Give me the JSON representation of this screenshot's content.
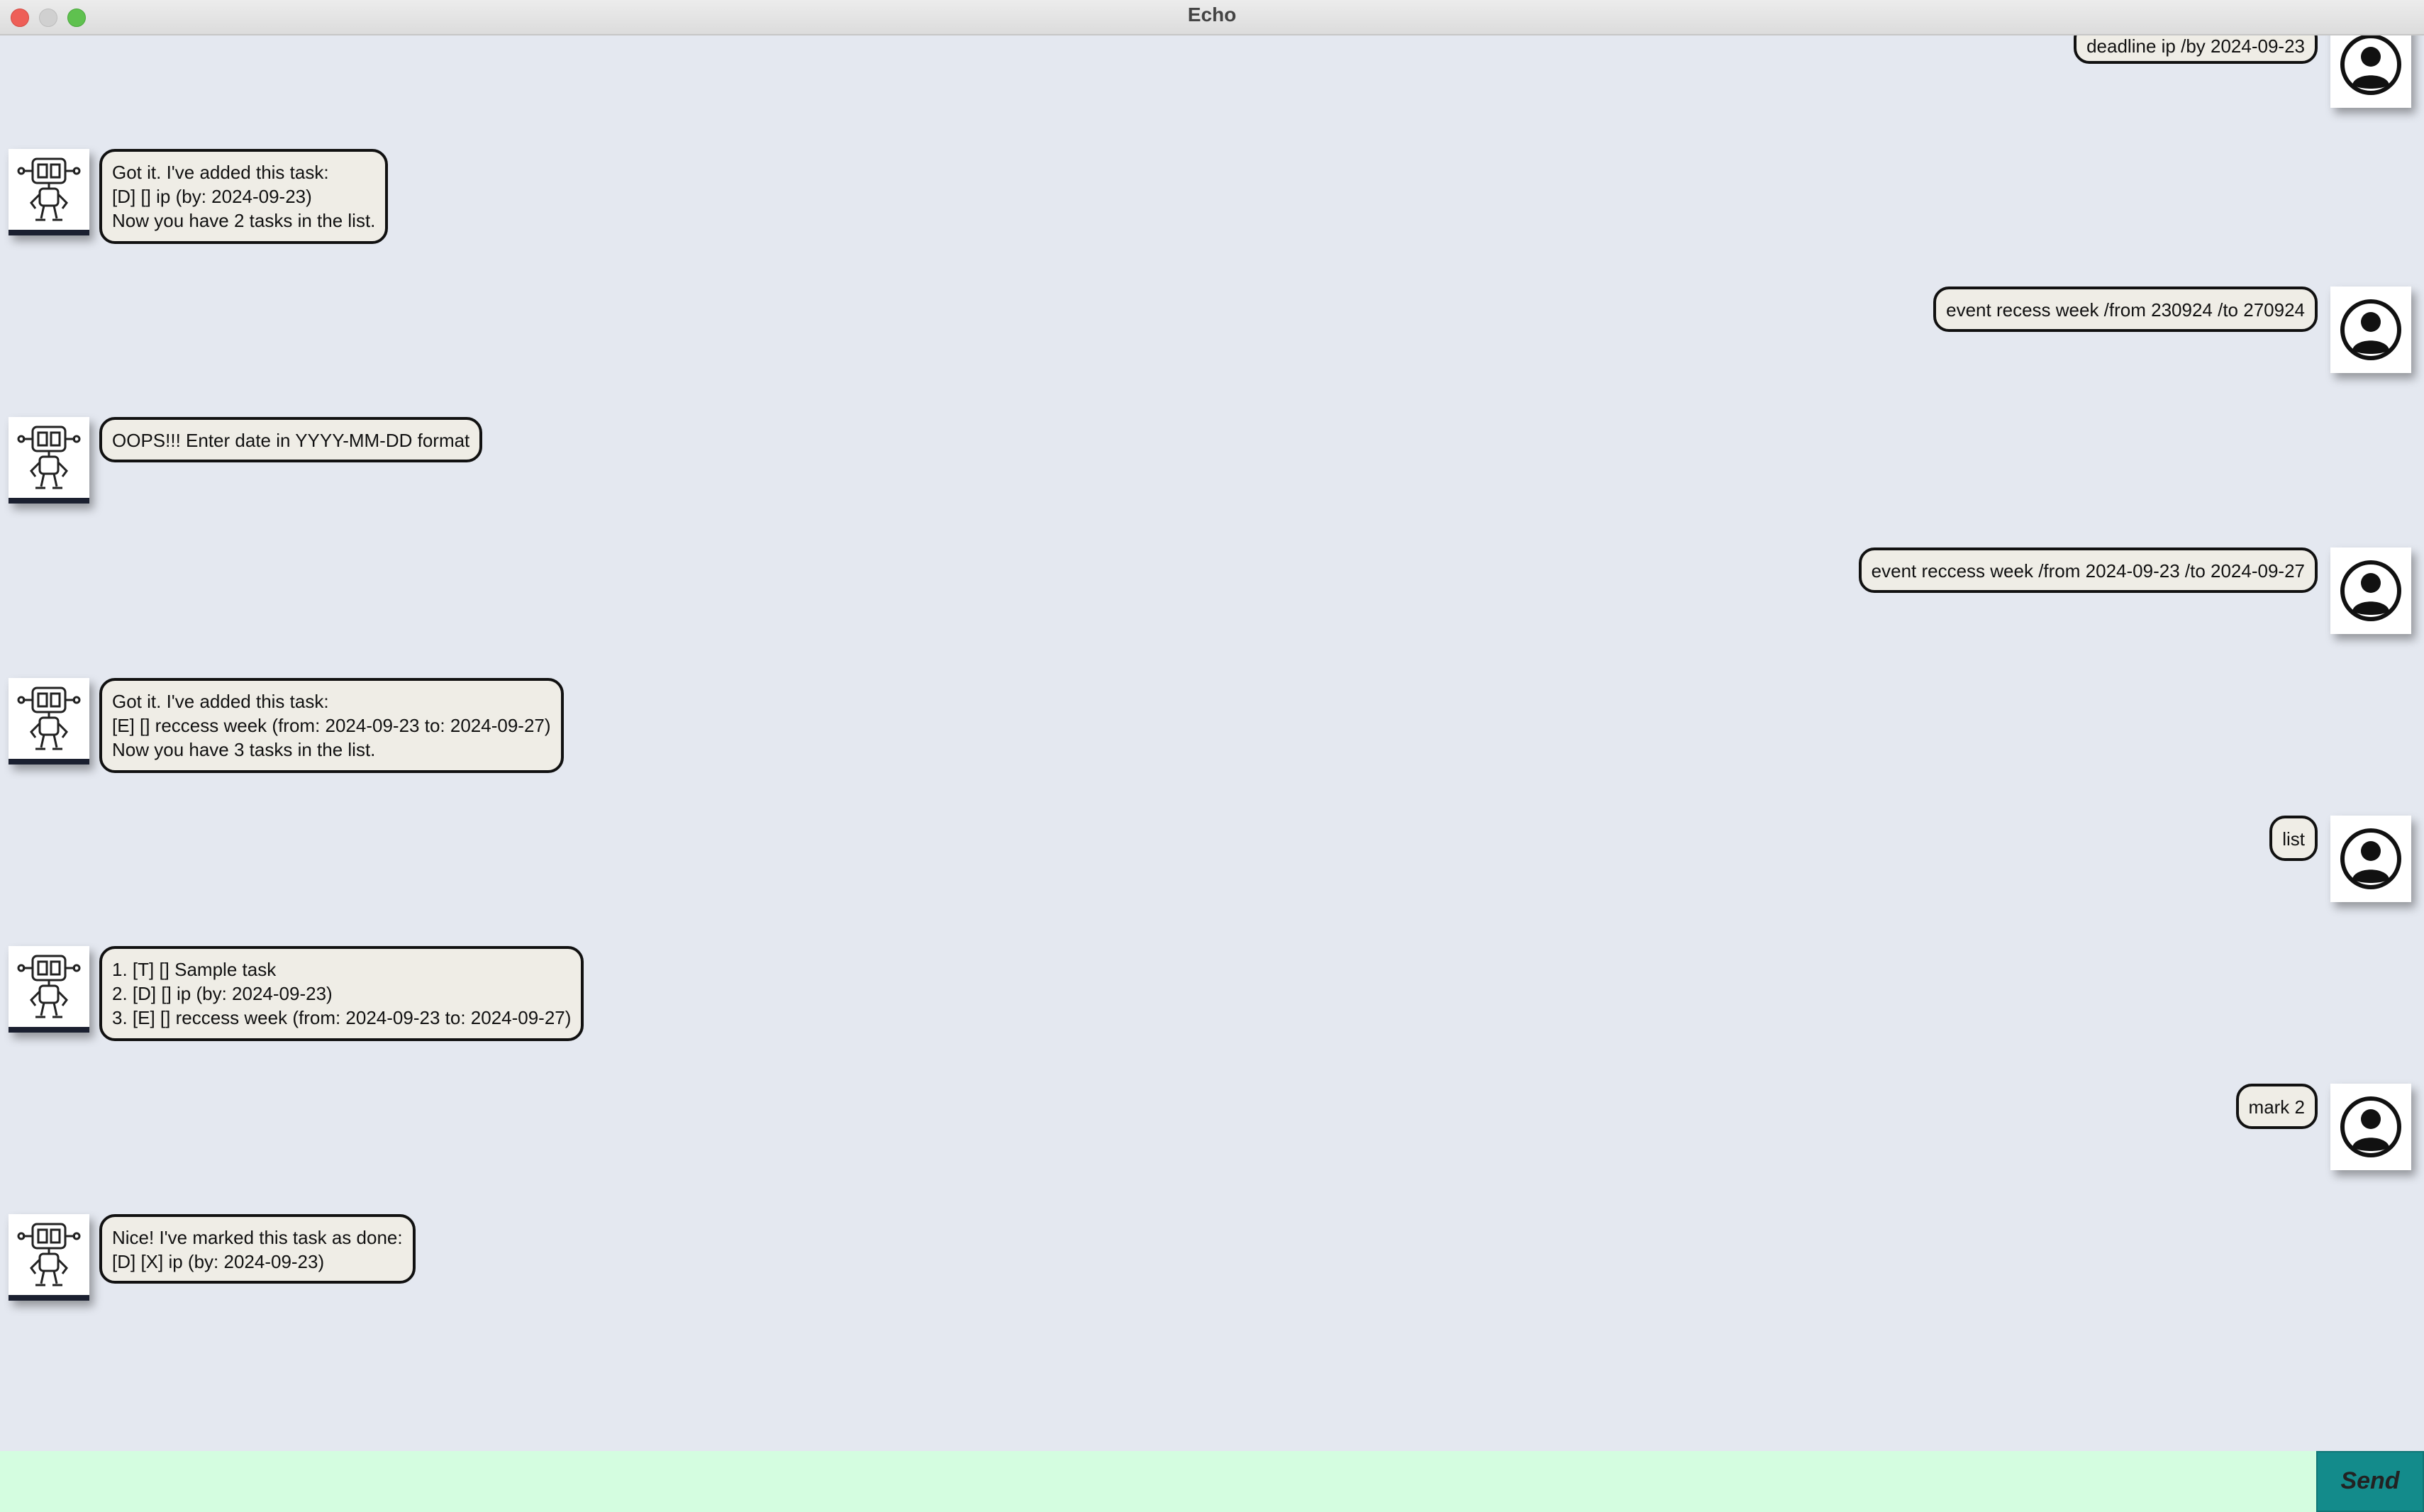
{
  "window": {
    "title": "Echo"
  },
  "messages": [
    {
      "sender": "user",
      "text": "deadline ip /by 2024-09-23"
    },
    {
      "sender": "bot",
      "text": "Got it. I've added this task:\n[D] [] ip (by: 2024-09-23)\nNow you have 2 tasks in the list."
    },
    {
      "sender": "user",
      "text": "event recess week /from 230924 /to 270924"
    },
    {
      "sender": "bot",
      "text": "OOPS!!! Enter date in YYYY-MM-DD format"
    },
    {
      "sender": "user",
      "text": "event reccess week /from 2024-09-23 /to 2024-09-27"
    },
    {
      "sender": "bot",
      "text": "Got it. I've added this task:\n[E] [] reccess week (from: 2024-09-23 to: 2024-09-27)\nNow you have 3 tasks in the list."
    },
    {
      "sender": "user",
      "text": "list"
    },
    {
      "sender": "bot",
      "text": "1. [T] [] Sample task\n2. [D] [] ip (by: 2024-09-23)\n3. [E] [] reccess week (from: 2024-09-23 to: 2024-09-27)"
    },
    {
      "sender": "user",
      "text": "mark 2"
    },
    {
      "sender": "bot",
      "text": "Nice! I've marked this task as done:\n[D] [X] ip (by: 2024-09-23)"
    }
  ],
  "input": {
    "value": "",
    "placeholder": ""
  },
  "send_button": {
    "label": "Send"
  },
  "icons": {
    "user_avatar": "user-avatar-icon",
    "bot_avatar": "robot-avatar-icon"
  },
  "colors": {
    "background": "#e4e8f0",
    "bubble": "#efede6",
    "input": "#d4fde0",
    "send": "#138b8b"
  }
}
